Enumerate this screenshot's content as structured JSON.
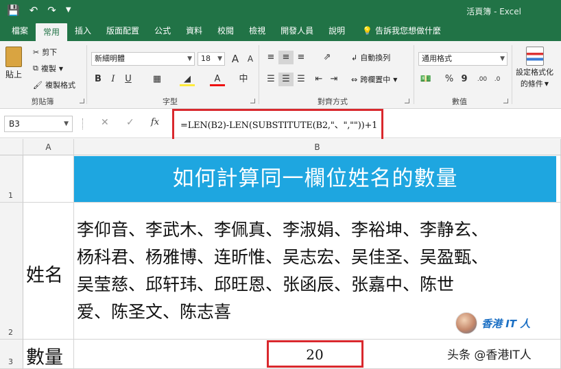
{
  "window": {
    "title": "活頁簿 - Excel"
  },
  "qat": {
    "save_icon": "save-icon",
    "undo_icon": "undo-icon",
    "redo_icon": "redo-icon",
    "customize_icon": "customize-qat-icon"
  },
  "tabs": [
    {
      "label": "檔案"
    },
    {
      "label": "常用"
    },
    {
      "label": "插入"
    },
    {
      "label": "版面配置"
    },
    {
      "label": "公式"
    },
    {
      "label": "資料"
    },
    {
      "label": "校閱"
    },
    {
      "label": "檢視"
    },
    {
      "label": "開發人員"
    },
    {
      "label": "說明"
    },
    {
      "label": "告訴我您想做什麼"
    }
  ],
  "ribbon": {
    "clipboard": {
      "label": "剪貼簿",
      "paste": "貼上",
      "cut": "剪下",
      "copy": "複製",
      "format_painter": "複製格式"
    },
    "font": {
      "label": "字型",
      "name": "新細明體",
      "size": "18",
      "bold": "B",
      "italic": "I",
      "underline": "U",
      "grow": "A",
      "shrink": "A",
      "phonetic": "中"
    },
    "alignment": {
      "label": "對齊方式",
      "wrap": "自動換列",
      "merge": "跨欄置中"
    },
    "number": {
      "label": "數值",
      "format": "通用格式",
      "percent": "%",
      "comma": "9"
    },
    "styles": {
      "conditional_1": "設定格式化",
      "conditional_2": "的條件"
    }
  },
  "formula_bar": {
    "name_box": "B3",
    "cancel": "✕",
    "enter": "✓",
    "fx": "fx",
    "formula": "=LEN(B2)-LEN(SUBSTITUTE(B2,\"、\",\"\"))+1"
  },
  "sheet": {
    "columns": [
      "A",
      "B"
    ],
    "rows": [
      "1",
      "2",
      "3"
    ],
    "title": "如何計算同一欄位姓名的數量",
    "a2": "姓名",
    "a3": "數量",
    "names_lines": [
      "李仰音、李武木、李佩真、李淑娟、李裕坤、李静玄、",
      "杨科君、杨雅博、连昕惟、吴志宏、吴佳圣、吴盈甄、",
      "吴莹慈、邱轩玮、邱旺恩、张函辰、张嘉中、陈世",
      "爱、陈圣文、陈志喜"
    ],
    "b3": "20"
  },
  "watermark": {
    "logo_text": "香港 IT 人",
    "handle": "头条 @香港IT人"
  }
}
